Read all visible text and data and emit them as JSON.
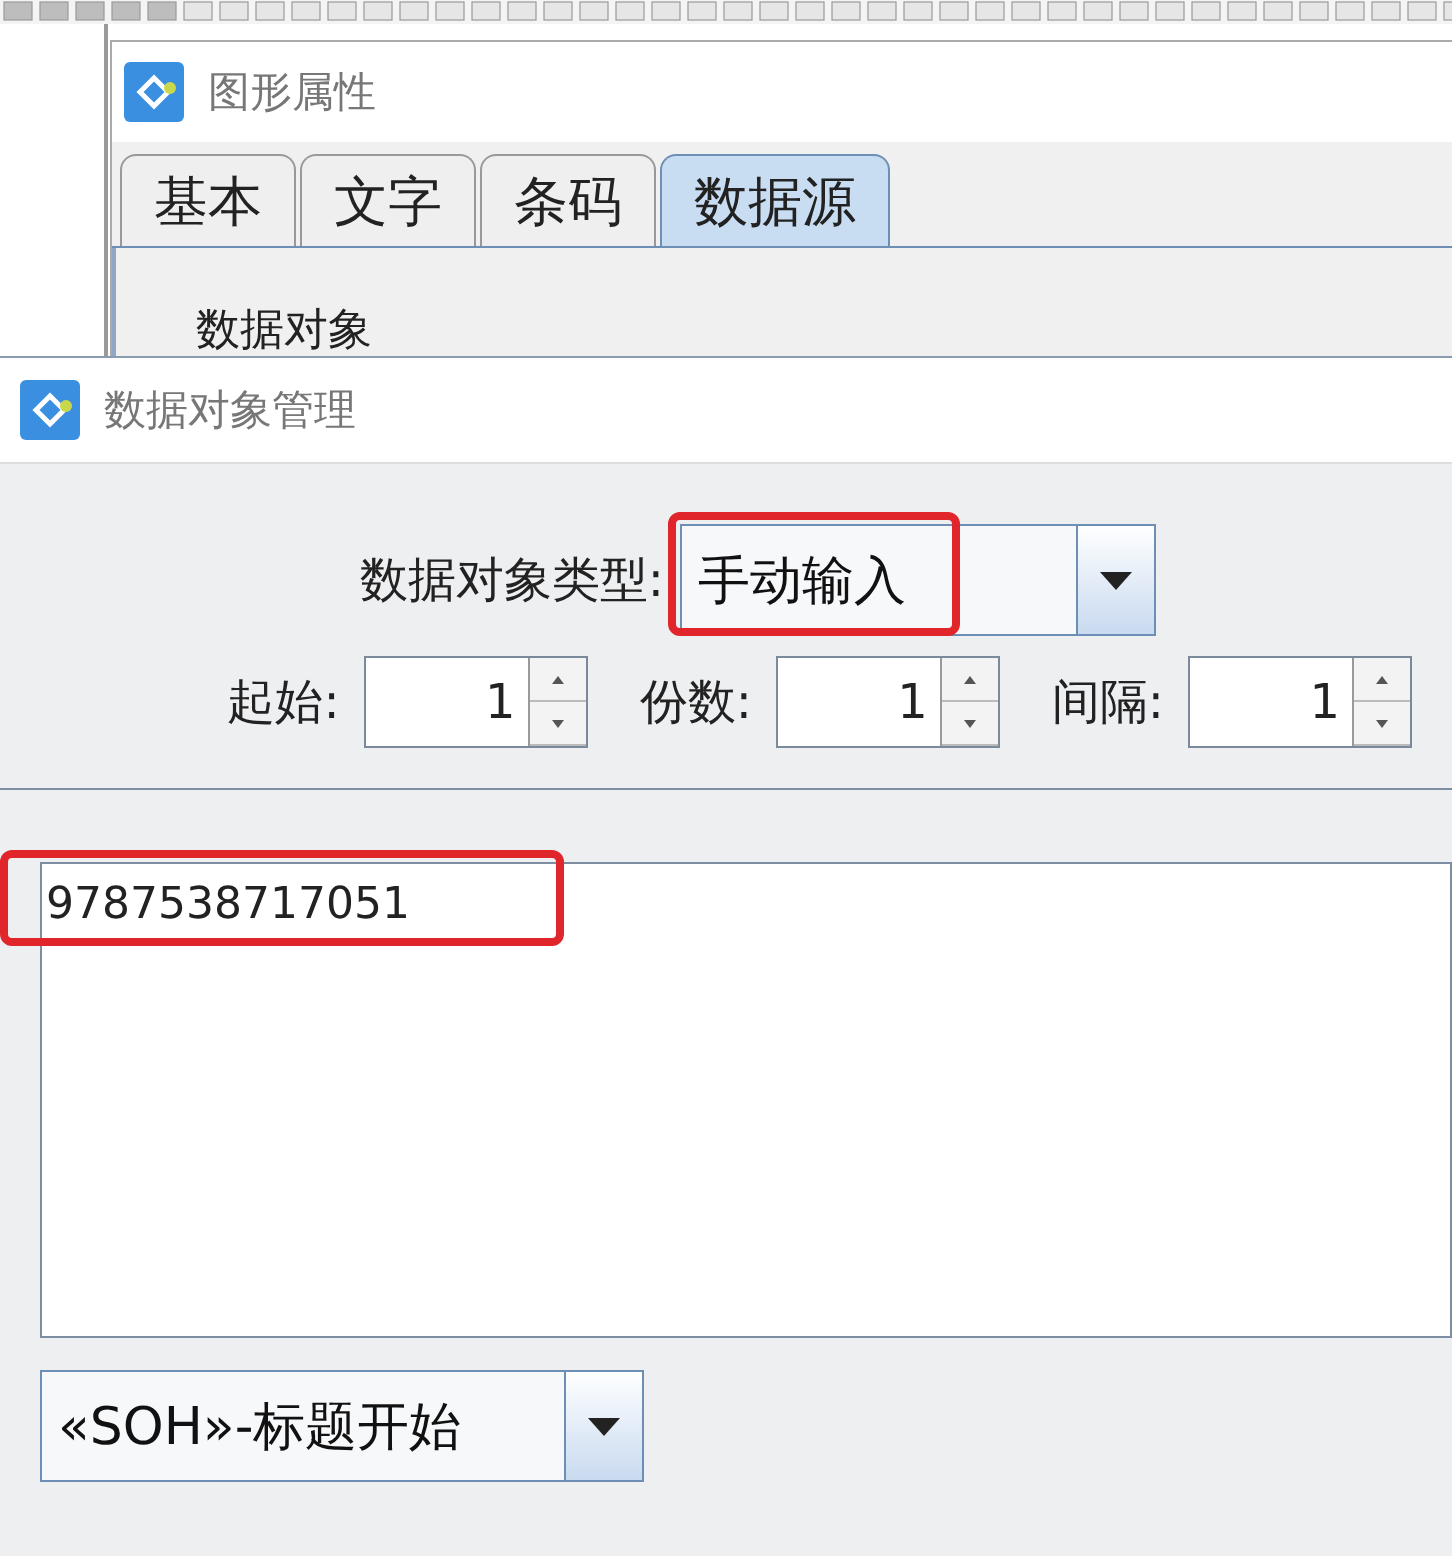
{
  "background_window": {
    "title": "图形属性",
    "tabs": [
      {
        "label": "基本",
        "selected": false
      },
      {
        "label": "文字",
        "selected": false
      },
      {
        "label": "条码",
        "selected": false
      },
      {
        "label": "数据源",
        "selected": true
      }
    ],
    "section_label": "数据对象"
  },
  "dialog": {
    "title": "数据对象管理",
    "type_field": {
      "label": "数据对象类型:",
      "value": "手动输入",
      "highlighted": true
    },
    "spinners": [
      {
        "label": "起始:",
        "value": "1"
      },
      {
        "label": "份数:",
        "value": "1"
      },
      {
        "label": "间隔:",
        "value": "1"
      }
    ],
    "text_area": {
      "value": "9787538717051",
      "highlighted": true
    },
    "control_char": {
      "value": "«SOH»-标题开始"
    }
  }
}
